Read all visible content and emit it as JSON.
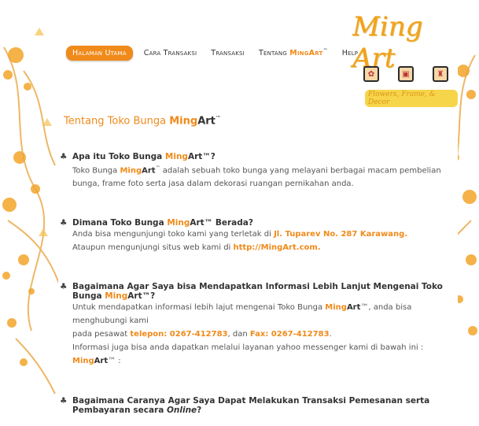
{
  "nav": {
    "items": [
      {
        "label": "Halaman Utama",
        "active": true
      },
      {
        "label": "Cara Transaksi",
        "active": false
      },
      {
        "label": "Transaksi",
        "active": false
      },
      {
        "label": "Tentang ",
        "brand_ming": "Ming",
        "brand_art": "Art",
        "tm": "™",
        "active": false
      },
      {
        "label": "Help",
        "active": false
      }
    ]
  },
  "logo": {
    "title": "Ming Art",
    "tagline": "Flowers, Frame, & Decor",
    "icons": [
      "flower-icon",
      "frame-icon",
      "decor-icon"
    ]
  },
  "heading": {
    "prefix": "Tentang Toko Bunga ",
    "ming": "Ming",
    "art": "Art",
    "tm": "™"
  },
  "qa": [
    {
      "question_prefix": "Apa itu Toko Bunga ",
      "question_ming": "Ming",
      "question_art": "Art",
      "question_suffix": "™?",
      "answer_prefix": "Toko Bunga ",
      "answer_ming": "Ming",
      "answer_art": "Art",
      "answer_tm": "™",
      "answer_text": " adalah sebuah toko bunga yang melayani berbagai macam pembelian bunga, frame foto serta jasa dalam dekorasi ruangan pernikahan anda."
    },
    {
      "question_prefix": "Dimana Toko Bunga ",
      "question_ming": "Ming",
      "question_art": "Art",
      "question_suffix": "™ Berada?",
      "line1_prefix": "Anda bisa mengunjungi toko kami yang terletak di ",
      "line1_highlight": "Jl. Tuparev No. 287 Karawang.",
      "line2_prefix": "Ataupun mengunjungi situs web kami di ",
      "line2_highlight": "http://MingArt.com."
    },
    {
      "question_prefix": "Bagaimana Agar Saya bisa Mendapatkan Informasi Lebih Lanjut Mengenai Toko Bunga ",
      "question_ming": "Ming",
      "question_art": "Art",
      "question_suffix": "™?",
      "line1_prefix": "Untuk mendapatkan informasi lebih lajut mengenai Toko Bunga ",
      "line1_ming": "Ming",
      "line1_art": "Art",
      "line1_suffix": "™, anda bisa menghubungi kami",
      "line2_prefix": "pada pesawat ",
      "line2_tel": "telepon: 0267-412783",
      "line2_mid": ", dan ",
      "line2_fax": "Fax: 0267-412783",
      "line2_end": ".",
      "line3": "Informasi juga bisa anda dapatkan melalui layanan yahoo messenger kami di bawah ini :",
      "line4_ming": "Ming",
      "line4_art": "Art",
      "line4_suffix": "™ :"
    },
    {
      "question": "Bagaimana Caranya Agar Saya Dapat Melakukan Transaksi Pemesanan serta Pembayaran secara ",
      "question_italic": "Online",
      "question_end": "?"
    }
  ],
  "colors": {
    "accent": "#f08a1a",
    "text": "#555555",
    "dark": "#333333"
  }
}
